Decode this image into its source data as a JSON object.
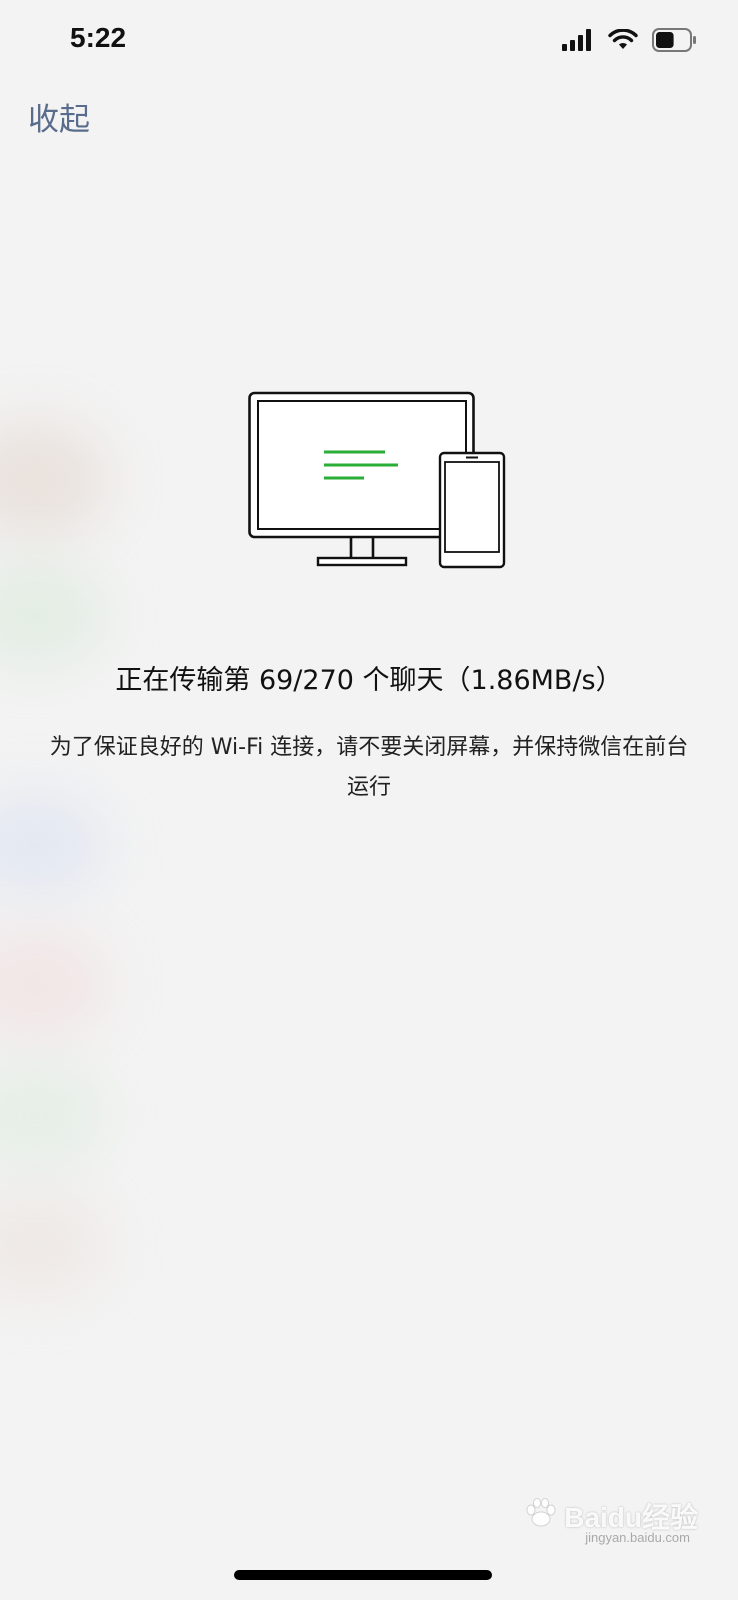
{
  "status_bar": {
    "time": "5:22",
    "icons": [
      "cellular-signal-icon",
      "wifi-icon",
      "battery-icon"
    ],
    "battery_level": 0.55
  },
  "nav": {
    "collapse_label": "收起"
  },
  "transfer": {
    "status_text": "正在传输第 69/270 个聊天（1.86MB/s）",
    "instruction_text": "为了保证良好的 Wi-Fi 连接，请不要关闭屏幕，并保持微信在前台运行"
  },
  "watermark": {
    "brand": "Baidu经验",
    "url": "jingyan.baidu.com"
  },
  "colors": {
    "accent_green": "#2aae35",
    "link_blue": "#5a6c8c"
  }
}
